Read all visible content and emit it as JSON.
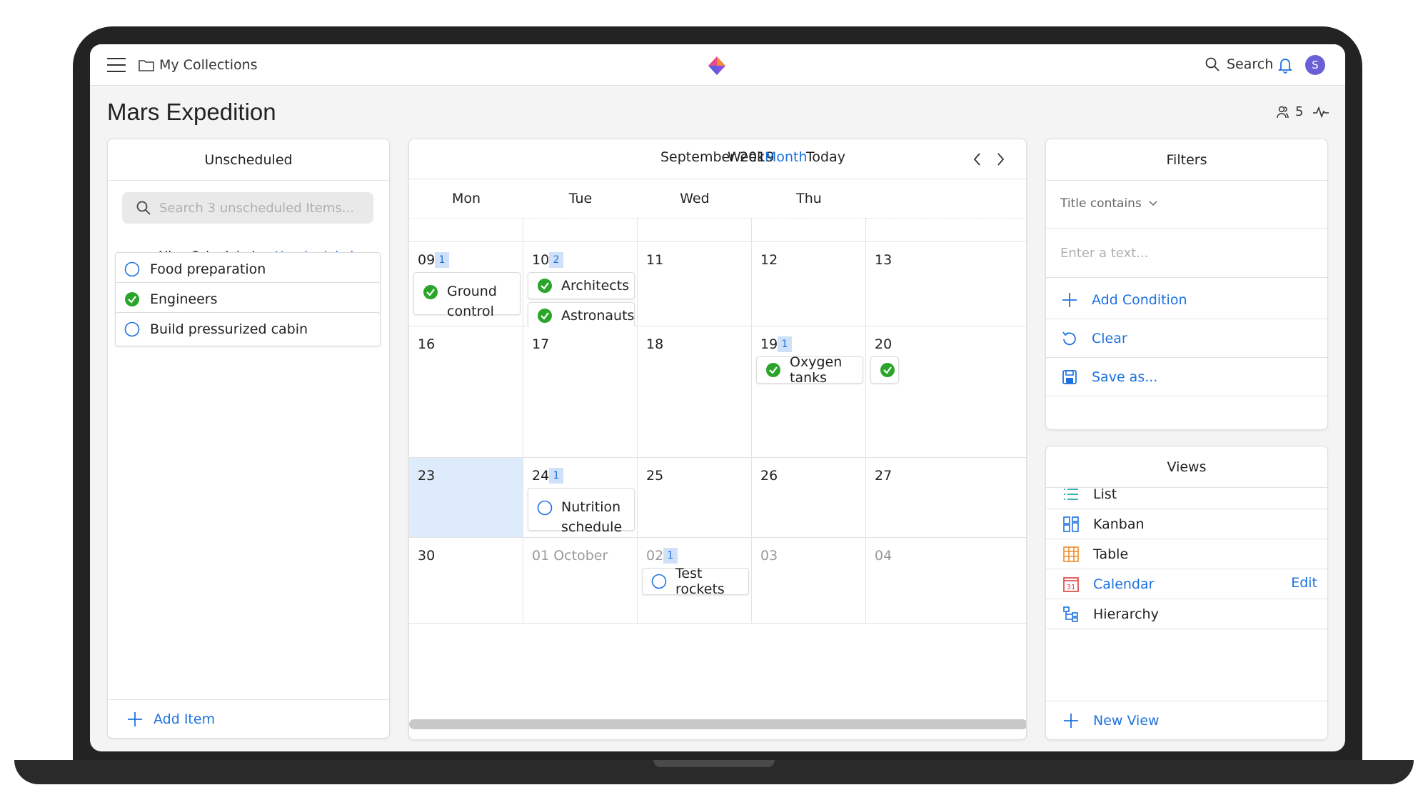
{
  "topbar": {
    "collections": "My Collections",
    "search_label": "Search",
    "avatar_initial": "S"
  },
  "page": {
    "title": "Mars Expedition",
    "contributors_count": "5"
  },
  "unscheduled": {
    "header": "Unscheduled",
    "search_placeholder": "Search 3 unscheduled Items...",
    "tabs": [
      "All",
      "Scheduled",
      "Unscheduled"
    ],
    "active_tab": "Unscheduled",
    "items": [
      {
        "title": "Food preparation",
        "done": false
      },
      {
        "title": "Engineers",
        "done": true
      },
      {
        "title": "Build pressurized cabin",
        "done": false
      }
    ],
    "add_label": "Add Item"
  },
  "calendar": {
    "month": "September 2019",
    "views": [
      "Week",
      "Month",
      "Today"
    ],
    "active_view": "Month",
    "weekdays": [
      "Mon",
      "Tue",
      "Wed",
      "Thu"
    ],
    "weeks": [
      [
        {
          "day": "09",
          "badge": "1",
          "events": [
            {
              "title": "Ground control",
              "done": true
            }
          ]
        },
        {
          "day": "10",
          "badge": "2",
          "events": [
            {
              "title": "Architects",
              "done": true
            },
            {
              "title": "Astronauts",
              "done": true
            }
          ]
        },
        {
          "day": "11"
        },
        {
          "day": "12"
        },
        {
          "day": "13"
        }
      ],
      [
        {
          "day": "16"
        },
        {
          "day": "17"
        },
        {
          "day": "18"
        },
        {
          "day": "19",
          "badge": "1",
          "events": [
            {
              "title": "Oxygen tanks",
              "done": true
            }
          ]
        },
        {
          "day": "20",
          "events": [
            {
              "title": "",
              "done": true
            }
          ]
        }
      ],
      [
        {
          "day": "23",
          "today": true
        },
        {
          "day": "24",
          "badge": "1",
          "events": [
            {
              "title": "Nutrition schedule",
              "done": false
            }
          ]
        },
        {
          "day": "25"
        },
        {
          "day": "26"
        },
        {
          "day": "27"
        }
      ],
      [
        {
          "day": "30"
        },
        {
          "day": "01 October",
          "muted": true
        },
        {
          "day": "02",
          "muted": true,
          "badge": "1",
          "events": [
            {
              "title": "Test rockets",
              "done": false
            }
          ]
        },
        {
          "day": "03",
          "muted": true
        },
        {
          "day": "04",
          "muted": true
        }
      ]
    ]
  },
  "filters": {
    "header": "Filters",
    "condition": "Title contains",
    "text_placeholder": "Enter a text...",
    "add_condition": "Add Condition",
    "clear": "Clear",
    "save_as": "Save as..."
  },
  "views": {
    "header": "Views",
    "items": [
      {
        "label": "List",
        "icon": "list-icon"
      },
      {
        "label": "Kanban",
        "icon": "kanban-icon"
      },
      {
        "label": "Table",
        "icon": "table-icon"
      },
      {
        "label": "Calendar",
        "icon": "calendar-icon"
      },
      {
        "label": "Hierarchy",
        "icon": "hierarchy-icon"
      }
    ],
    "active": "Calendar",
    "edit_label": "Edit",
    "new_view": "New View"
  },
  "colors": {
    "accent": "#1d72e0",
    "done_green": "#2aa52a",
    "today_bg": "#deebfa"
  }
}
